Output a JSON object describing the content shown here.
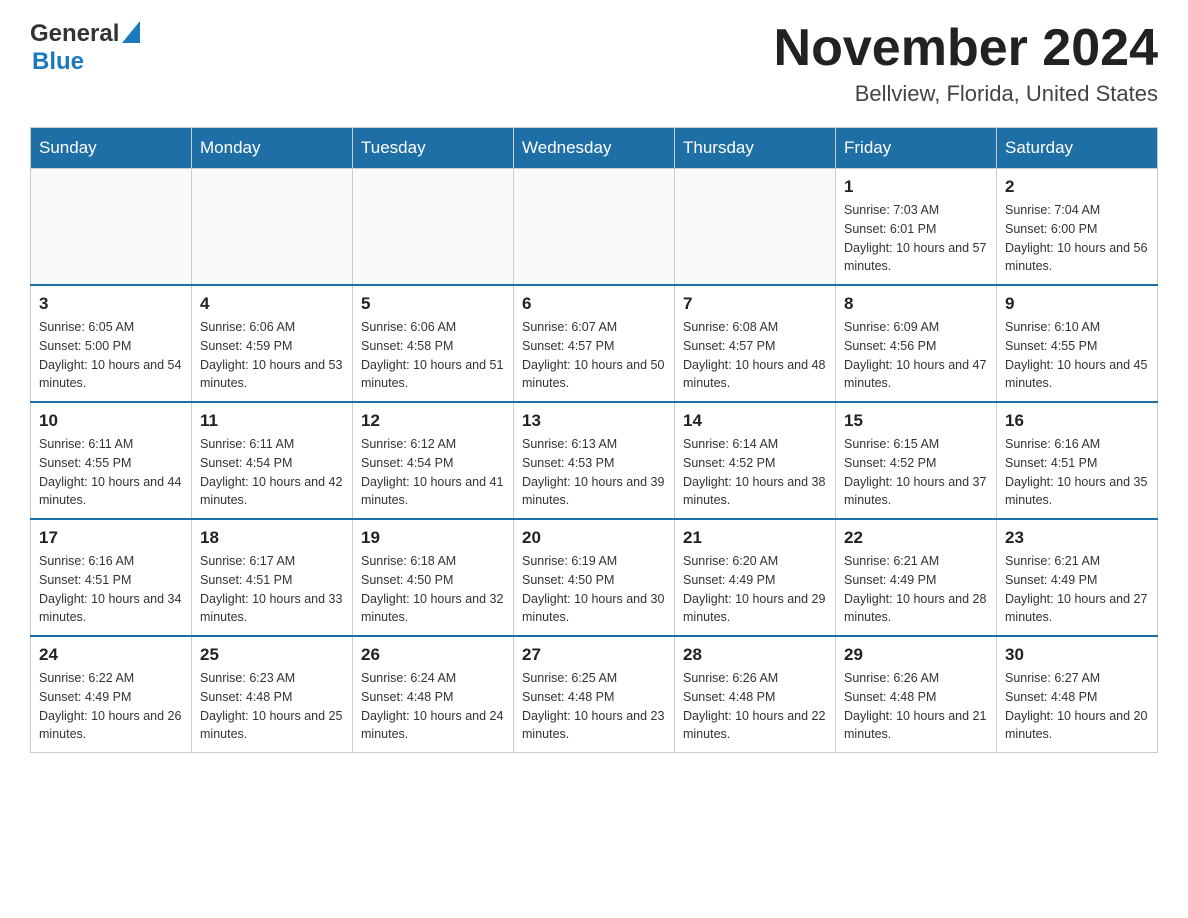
{
  "header": {
    "logo_general": "General",
    "logo_blue": "Blue",
    "month_title": "November 2024",
    "location": "Bellview, Florida, United States"
  },
  "weekdays": [
    "Sunday",
    "Monday",
    "Tuesday",
    "Wednesday",
    "Thursday",
    "Friday",
    "Saturday"
  ],
  "weeks": [
    [
      {
        "day": "",
        "info": ""
      },
      {
        "day": "",
        "info": ""
      },
      {
        "day": "",
        "info": ""
      },
      {
        "day": "",
        "info": ""
      },
      {
        "day": "",
        "info": ""
      },
      {
        "day": "1",
        "info": "Sunrise: 7:03 AM\nSunset: 6:01 PM\nDaylight: 10 hours and 57 minutes."
      },
      {
        "day": "2",
        "info": "Sunrise: 7:04 AM\nSunset: 6:00 PM\nDaylight: 10 hours and 56 minutes."
      }
    ],
    [
      {
        "day": "3",
        "info": "Sunrise: 6:05 AM\nSunset: 5:00 PM\nDaylight: 10 hours and 54 minutes."
      },
      {
        "day": "4",
        "info": "Sunrise: 6:06 AM\nSunset: 4:59 PM\nDaylight: 10 hours and 53 minutes."
      },
      {
        "day": "5",
        "info": "Sunrise: 6:06 AM\nSunset: 4:58 PM\nDaylight: 10 hours and 51 minutes."
      },
      {
        "day": "6",
        "info": "Sunrise: 6:07 AM\nSunset: 4:57 PM\nDaylight: 10 hours and 50 minutes."
      },
      {
        "day": "7",
        "info": "Sunrise: 6:08 AM\nSunset: 4:57 PM\nDaylight: 10 hours and 48 minutes."
      },
      {
        "day": "8",
        "info": "Sunrise: 6:09 AM\nSunset: 4:56 PM\nDaylight: 10 hours and 47 minutes."
      },
      {
        "day": "9",
        "info": "Sunrise: 6:10 AM\nSunset: 4:55 PM\nDaylight: 10 hours and 45 minutes."
      }
    ],
    [
      {
        "day": "10",
        "info": "Sunrise: 6:11 AM\nSunset: 4:55 PM\nDaylight: 10 hours and 44 minutes."
      },
      {
        "day": "11",
        "info": "Sunrise: 6:11 AM\nSunset: 4:54 PM\nDaylight: 10 hours and 42 minutes."
      },
      {
        "day": "12",
        "info": "Sunrise: 6:12 AM\nSunset: 4:54 PM\nDaylight: 10 hours and 41 minutes."
      },
      {
        "day": "13",
        "info": "Sunrise: 6:13 AM\nSunset: 4:53 PM\nDaylight: 10 hours and 39 minutes."
      },
      {
        "day": "14",
        "info": "Sunrise: 6:14 AM\nSunset: 4:52 PM\nDaylight: 10 hours and 38 minutes."
      },
      {
        "day": "15",
        "info": "Sunrise: 6:15 AM\nSunset: 4:52 PM\nDaylight: 10 hours and 37 minutes."
      },
      {
        "day": "16",
        "info": "Sunrise: 6:16 AM\nSunset: 4:51 PM\nDaylight: 10 hours and 35 minutes."
      }
    ],
    [
      {
        "day": "17",
        "info": "Sunrise: 6:16 AM\nSunset: 4:51 PM\nDaylight: 10 hours and 34 minutes."
      },
      {
        "day": "18",
        "info": "Sunrise: 6:17 AM\nSunset: 4:51 PM\nDaylight: 10 hours and 33 minutes."
      },
      {
        "day": "19",
        "info": "Sunrise: 6:18 AM\nSunset: 4:50 PM\nDaylight: 10 hours and 32 minutes."
      },
      {
        "day": "20",
        "info": "Sunrise: 6:19 AM\nSunset: 4:50 PM\nDaylight: 10 hours and 30 minutes."
      },
      {
        "day": "21",
        "info": "Sunrise: 6:20 AM\nSunset: 4:49 PM\nDaylight: 10 hours and 29 minutes."
      },
      {
        "day": "22",
        "info": "Sunrise: 6:21 AM\nSunset: 4:49 PM\nDaylight: 10 hours and 28 minutes."
      },
      {
        "day": "23",
        "info": "Sunrise: 6:21 AM\nSunset: 4:49 PM\nDaylight: 10 hours and 27 minutes."
      }
    ],
    [
      {
        "day": "24",
        "info": "Sunrise: 6:22 AM\nSunset: 4:49 PM\nDaylight: 10 hours and 26 minutes."
      },
      {
        "day": "25",
        "info": "Sunrise: 6:23 AM\nSunset: 4:48 PM\nDaylight: 10 hours and 25 minutes."
      },
      {
        "day": "26",
        "info": "Sunrise: 6:24 AM\nSunset: 4:48 PM\nDaylight: 10 hours and 24 minutes."
      },
      {
        "day": "27",
        "info": "Sunrise: 6:25 AM\nSunset: 4:48 PM\nDaylight: 10 hours and 23 minutes."
      },
      {
        "day": "28",
        "info": "Sunrise: 6:26 AM\nSunset: 4:48 PM\nDaylight: 10 hours and 22 minutes."
      },
      {
        "day": "29",
        "info": "Sunrise: 6:26 AM\nSunset: 4:48 PM\nDaylight: 10 hours and 21 minutes."
      },
      {
        "day": "30",
        "info": "Sunrise: 6:27 AM\nSunset: 4:48 PM\nDaylight: 10 hours and 20 minutes."
      }
    ]
  ]
}
